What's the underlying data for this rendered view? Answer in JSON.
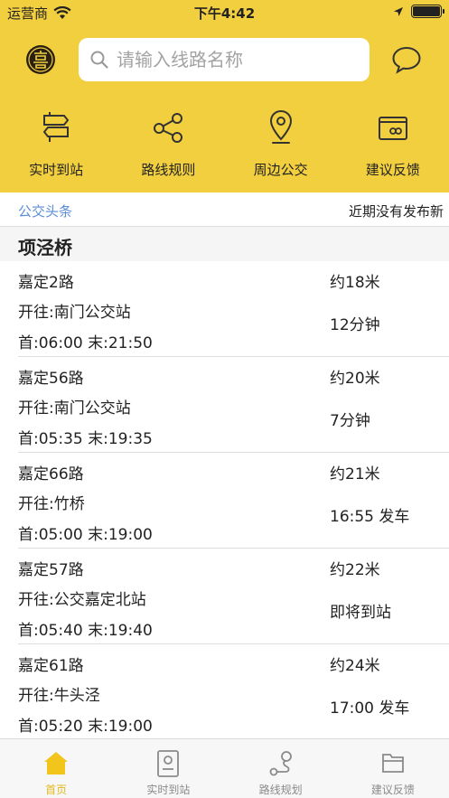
{
  "status_bar": {
    "carrier": "运营商",
    "time": "下午4:42"
  },
  "search": {
    "placeholder": "请输入线路名称"
  },
  "quick_actions": [
    {
      "label": "实时到站",
      "icon": "signpost-icon"
    },
    {
      "label": "路线规则",
      "icon": "share-nodes-icon"
    },
    {
      "label": "周边公交",
      "icon": "location-pin-icon"
    },
    {
      "label": "建议反馈",
      "icon": "feedback-card-icon"
    }
  ],
  "news": {
    "tag": "公交头条",
    "text": "近期没有发布新"
  },
  "station": {
    "name": "项泾桥"
  },
  "routes": [
    {
      "name": "嘉定2路",
      "destination": "开往:南门公交站",
      "times": "首:06:00 末:21:50",
      "distance": "约18米",
      "eta": "12分钟"
    },
    {
      "name": "嘉定56路",
      "destination": "开往:南门公交站",
      "times": "首:05:35 末:19:35",
      "distance": "约20米",
      "eta": "7分钟"
    },
    {
      "name": "嘉定66路",
      "destination": "开往:竹桥",
      "times": "首:05:00 末:19:00",
      "distance": "约21米",
      "eta": "16:55 发车"
    },
    {
      "name": "嘉定57路",
      "destination": "开往:公交嘉定北站",
      "times": "首:05:40 末:19:40",
      "distance": "约22米",
      "eta": "即将到站"
    },
    {
      "name": "嘉定61路",
      "destination": "开往:牛头泾",
      "times": "首:05:20 末:19:00",
      "distance": "约24米",
      "eta": "17:00 发车"
    }
  ],
  "tabs": [
    {
      "label": "首页",
      "icon": "home-icon",
      "active": true
    },
    {
      "label": "实时到站",
      "icon": "realtime-card-icon",
      "active": false
    },
    {
      "label": "路线规划",
      "icon": "route-plan-icon",
      "active": false
    },
    {
      "label": "建议反馈",
      "icon": "folder-icon",
      "active": false
    }
  ],
  "colors": {
    "brand_yellow": "#f2cf3f",
    "tab_active": "#e3b91d",
    "link_blue": "#5b8ed6"
  }
}
